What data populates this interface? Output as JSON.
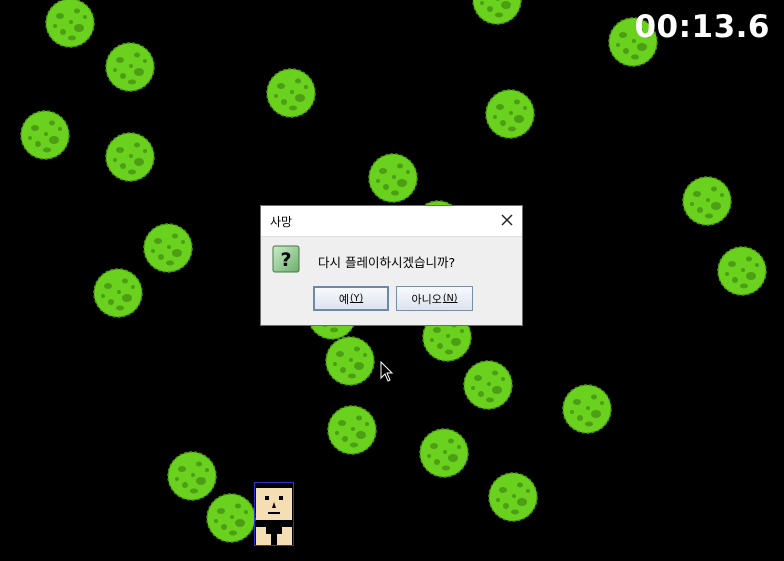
{
  "timer": "00:13.6",
  "asteroid_color": "#6ad11e",
  "asteroid_count": 30,
  "dialog": {
    "title": "사망",
    "message": "다시 플레이하시겠습니까?",
    "yes_label": "예",
    "yes_mnemonic": "(Y)",
    "no_label": "아니오",
    "no_mnemonic": "(N)",
    "icon": "question-icon"
  }
}
